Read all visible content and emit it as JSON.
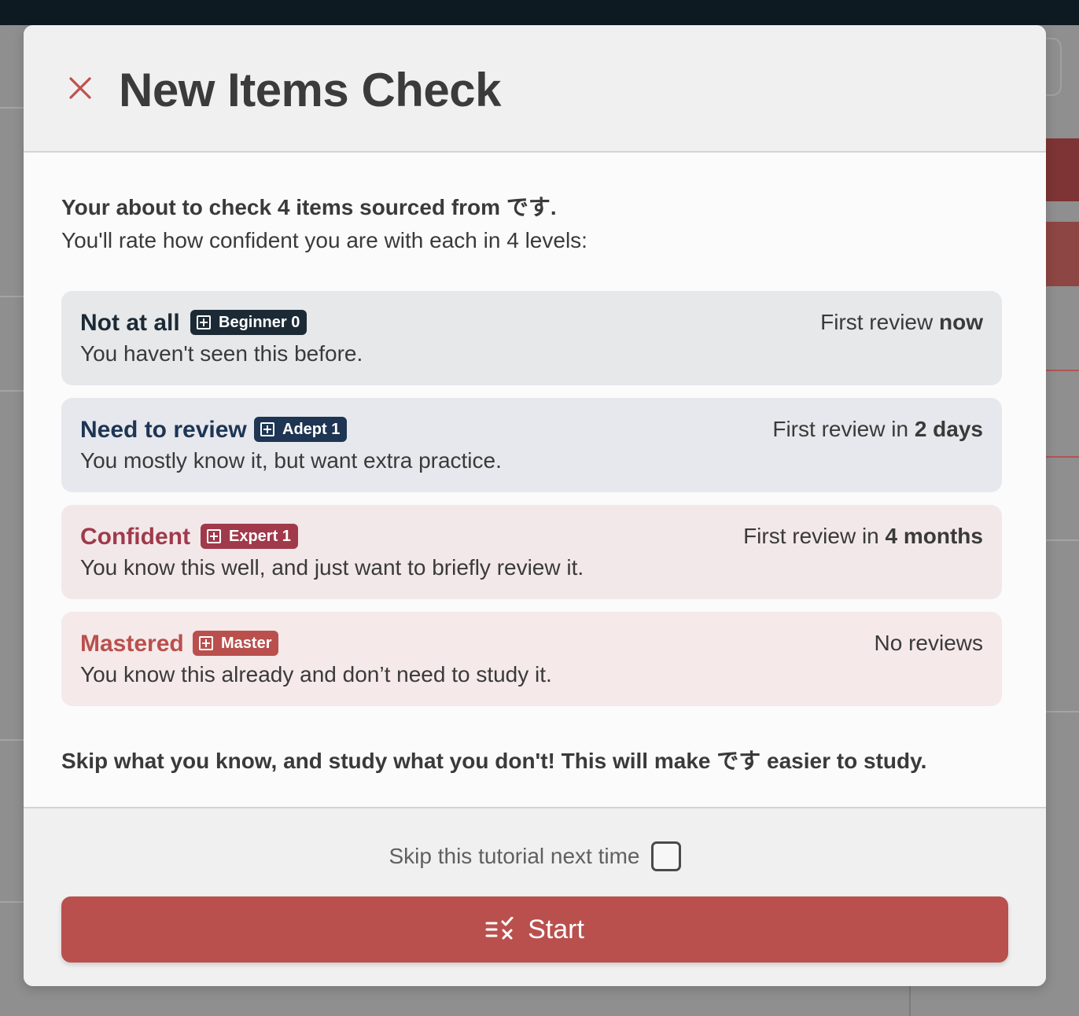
{
  "modal": {
    "title": "New Items Check",
    "close_icon": "close-icon"
  },
  "intro": {
    "line1": "Your about to check 4 items sourced from です.",
    "line2": "You'll rate how confident you are with each in 4 levels:"
  },
  "levels": [
    {
      "name": "Not at all",
      "badge": "Beginner 0",
      "description": "You haven't seen this before.",
      "when_prefix": "First review ",
      "when_bold": "now",
      "color": "#1c2a35"
    },
    {
      "name": "Need to review",
      "badge": "Adept 1",
      "description": "You mostly know it, but want extra practice.",
      "when_prefix": "First review in ",
      "when_bold": "2 days",
      "color": "#1e3553"
    },
    {
      "name": "Confident",
      "badge": "Expert 1",
      "description": "You know this well, and just want to briefly review it.",
      "when_prefix": "First review in ",
      "when_bold": "4 months",
      "color": "#a03a4b"
    },
    {
      "name": "Mastered",
      "badge": "Master",
      "description": "You know this already and don’t need to study it.",
      "when_prefix": "No reviews",
      "when_bold": "",
      "color": "#b9504d"
    }
  ],
  "outro": "Skip what you know, and study what you don't! This will make です easier to study.",
  "footer": {
    "skip_label": "Skip this tutorial next time",
    "skip_checked": false,
    "start_label": "Start",
    "start_icon": "checklist-icon",
    "accent": "#b9504d"
  }
}
